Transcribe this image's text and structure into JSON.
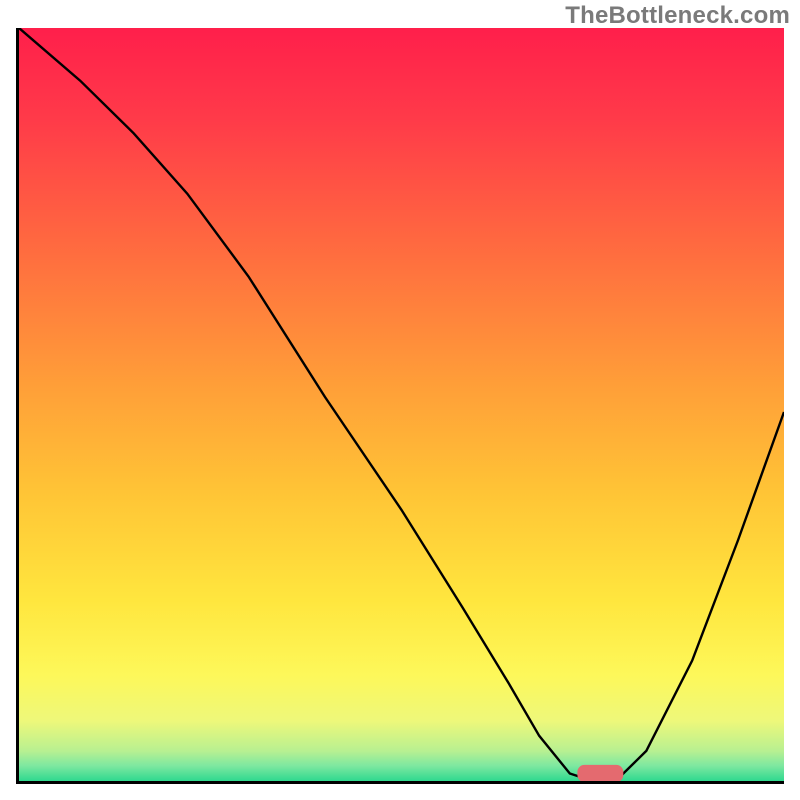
{
  "watermark": "TheBottleneck.com",
  "colors": {
    "gradient_top": "#ff1f4b",
    "gradient_bottom": "#2fd98f",
    "curve": "#000000",
    "marker": "#e46a6f",
    "axes": "#000000",
    "watermark": "#7a7a7a"
  },
  "chart_data": {
    "type": "line",
    "title": "",
    "xlabel": "",
    "ylabel": "",
    "xlim": [
      0,
      100
    ],
    "ylim": [
      0,
      100
    ],
    "x": [
      0,
      8,
      15,
      22,
      30,
      40,
      50,
      58,
      64,
      68,
      72,
      75,
      78,
      82,
      88,
      94,
      100
    ],
    "values": [
      100,
      93,
      86,
      78,
      67,
      51,
      36,
      23,
      13,
      6,
      1,
      0,
      0,
      4,
      16,
      32,
      49
    ],
    "marker": {
      "x_start": 73,
      "x_end": 79,
      "y": 0,
      "height": 2
    },
    "background_gradient": [
      {
        "pos": 0,
        "color": "#ff1f4b"
      },
      {
        "pos": 30,
        "color": "#ff6d3f"
      },
      {
        "pos": 62,
        "color": "#ffc536"
      },
      {
        "pos": 86,
        "color": "#fdf85a"
      },
      {
        "pos": 100,
        "color": "#2fd98f"
      }
    ]
  }
}
